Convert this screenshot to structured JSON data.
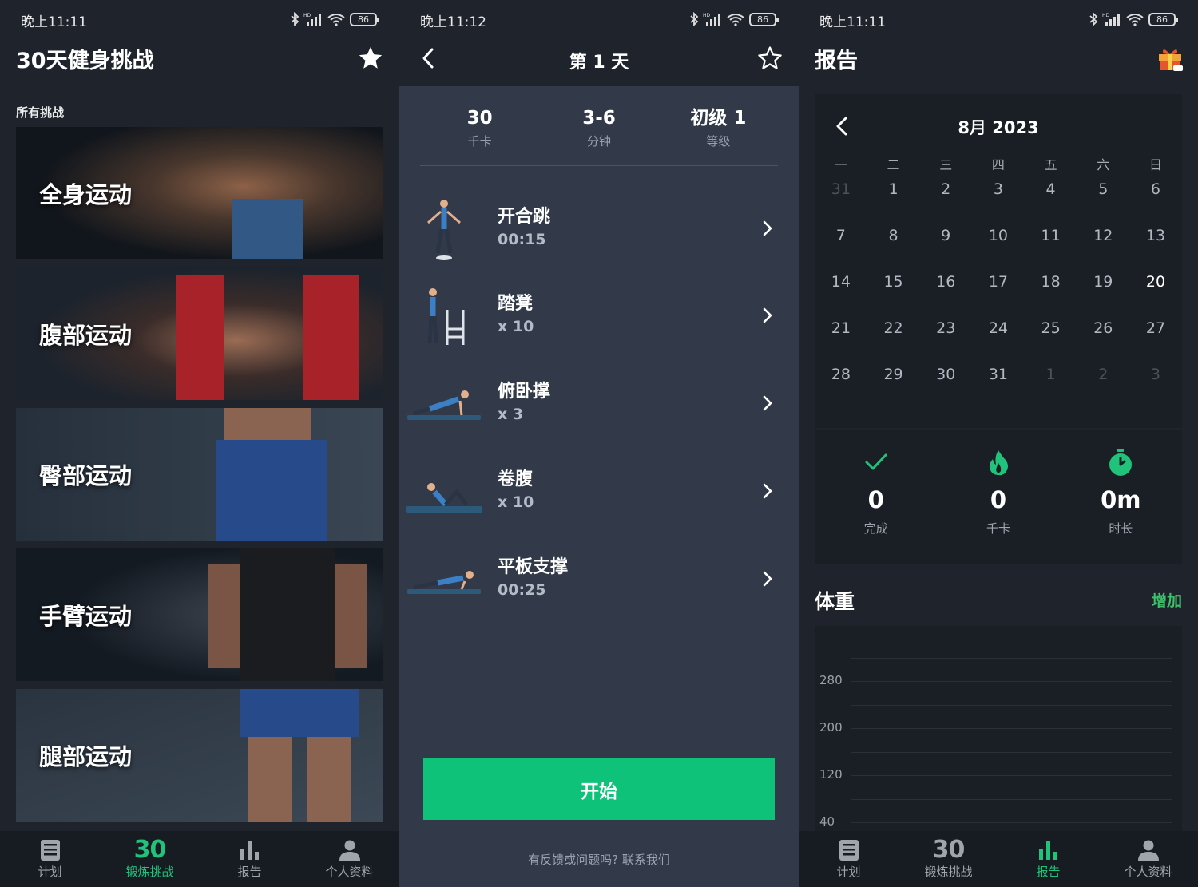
{
  "status": {
    "screen1_time": "晚上11:11",
    "screen2_time": "晚上11:12",
    "screen3_time": "晚上11:11",
    "battery": "86"
  },
  "screen1": {
    "title": "30天健身挑战",
    "section": "所有挑战",
    "cards": [
      {
        "label": "全身运动"
      },
      {
        "label": "腹部运动"
      },
      {
        "label": "臀部运动"
      },
      {
        "label": "手臂运动"
      },
      {
        "label": "腿部运动"
      }
    ]
  },
  "tabs": {
    "plan": "计划",
    "challenge_num": "30",
    "challenge": "锻炼挑战",
    "report": "报告",
    "profile": "个人资料"
  },
  "screen2": {
    "title": "第 1 天",
    "stats": [
      {
        "value": "30",
        "label": "千卡"
      },
      {
        "value": "3-6",
        "label": "分钟"
      },
      {
        "value": "初级 1",
        "label": "等级"
      }
    ],
    "exercises": [
      {
        "name": "开合跳",
        "qty": "00:15"
      },
      {
        "name": "踏凳",
        "qty": "x 10"
      },
      {
        "name": "俯卧撑",
        "qty": "x 3"
      },
      {
        "name": "卷腹",
        "qty": "x 10"
      },
      {
        "name": "平板支撑",
        "qty": "00:25"
      }
    ],
    "start": "开始",
    "feedback": "有反馈或问题吗? 联系我们"
  },
  "screen3": {
    "title": "报告",
    "calendar": {
      "month": "8月 2023",
      "weekdays": [
        "一",
        "二",
        "三",
        "四",
        "五",
        "六",
        "日"
      ],
      "weeks": [
        [
          "31",
          "1",
          "2",
          "3",
          "4",
          "5",
          "6"
        ],
        [
          "7",
          "8",
          "9",
          "10",
          "11",
          "12",
          "13"
        ],
        [
          "14",
          "15",
          "16",
          "17",
          "18",
          "19",
          "20"
        ],
        [
          "21",
          "22",
          "23",
          "24",
          "25",
          "26",
          "27"
        ],
        [
          "28",
          "29",
          "30",
          "31",
          "1",
          "2",
          "3"
        ]
      ],
      "today": "20"
    },
    "summary": [
      {
        "value": "0",
        "label": "完成",
        "icon": "check-icon"
      },
      {
        "value": "0",
        "label": "千卡",
        "icon": "flame-icon"
      },
      {
        "value": "0m",
        "label": "时长",
        "icon": "stopwatch-icon"
      }
    ],
    "weight_title": "体重",
    "weight_add": "增加",
    "weight_ticks": [
      "280",
      "200",
      "120",
      "40"
    ]
  },
  "colors": {
    "accent": "#0ec27a",
    "add_green": "#3fc26b",
    "bg_dark": "#1f242c",
    "bg_panel": "#323a4a"
  }
}
